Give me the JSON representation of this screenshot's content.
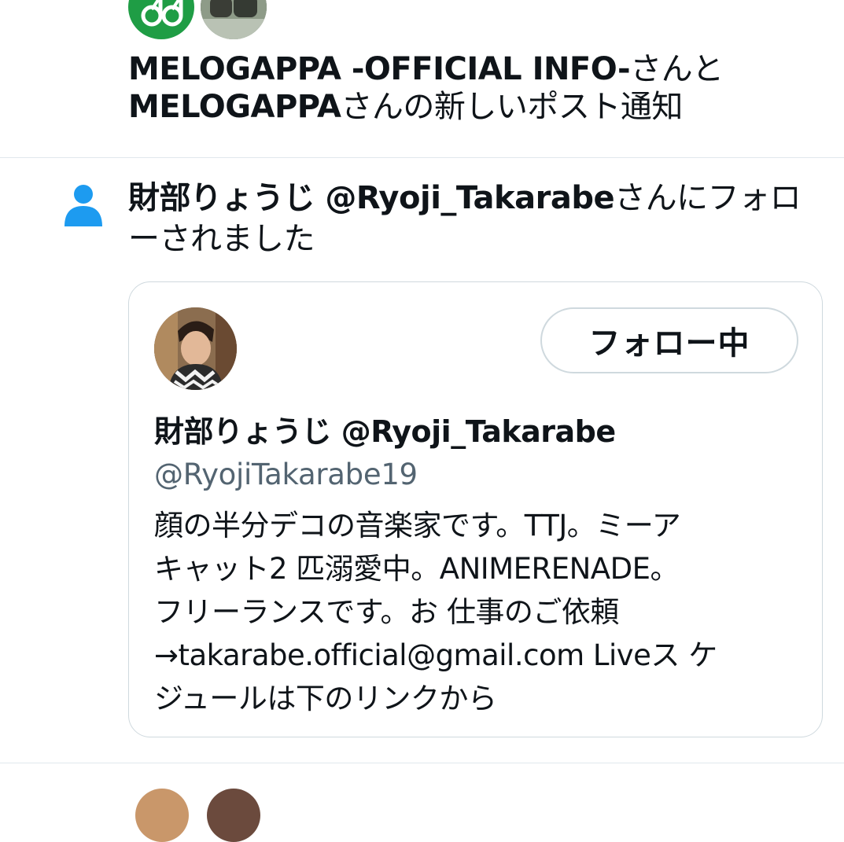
{
  "post_notification": {
    "icon": "bell-icon",
    "avatars": [
      "melogappa-official-avatar",
      "melogappa-avatar"
    ],
    "line1_bold": "MELOGAPPA -OFFICIAL INFO-",
    "line1_rest": "さんと",
    "line2_bold": "MELOGAPPA",
    "line2_rest": "さんの新しいポスト通知"
  },
  "follow_notification": {
    "icon": "person-icon",
    "name_bold": "財部りょうじ @Ryoji_Takarabe",
    "rest_line1": "さんにフォロ",
    "rest_line2": "ーされました"
  },
  "profile_card": {
    "follow_button_label": "フォロー中",
    "display_name": "財部りょうじ @Ryoji_Takarabe",
    "handle": "@RyojiTakarabe19",
    "bio_lines": [
      "顔の半分デコの音楽家です。TTJ。ミーア",
      "キャット2 匹溺愛中。ANIMERENADE。",
      "フリーランスです。お 仕事のご依頼",
      "→takarabe.official@gmail.com Liveス ケ",
      "ジュールは下のリンクから"
    ]
  },
  "colors": {
    "icon_blue": "#1d9bf0",
    "divider": "#e1e8ed",
    "secondary_text": "#536471",
    "border": "#cfd9de"
  }
}
